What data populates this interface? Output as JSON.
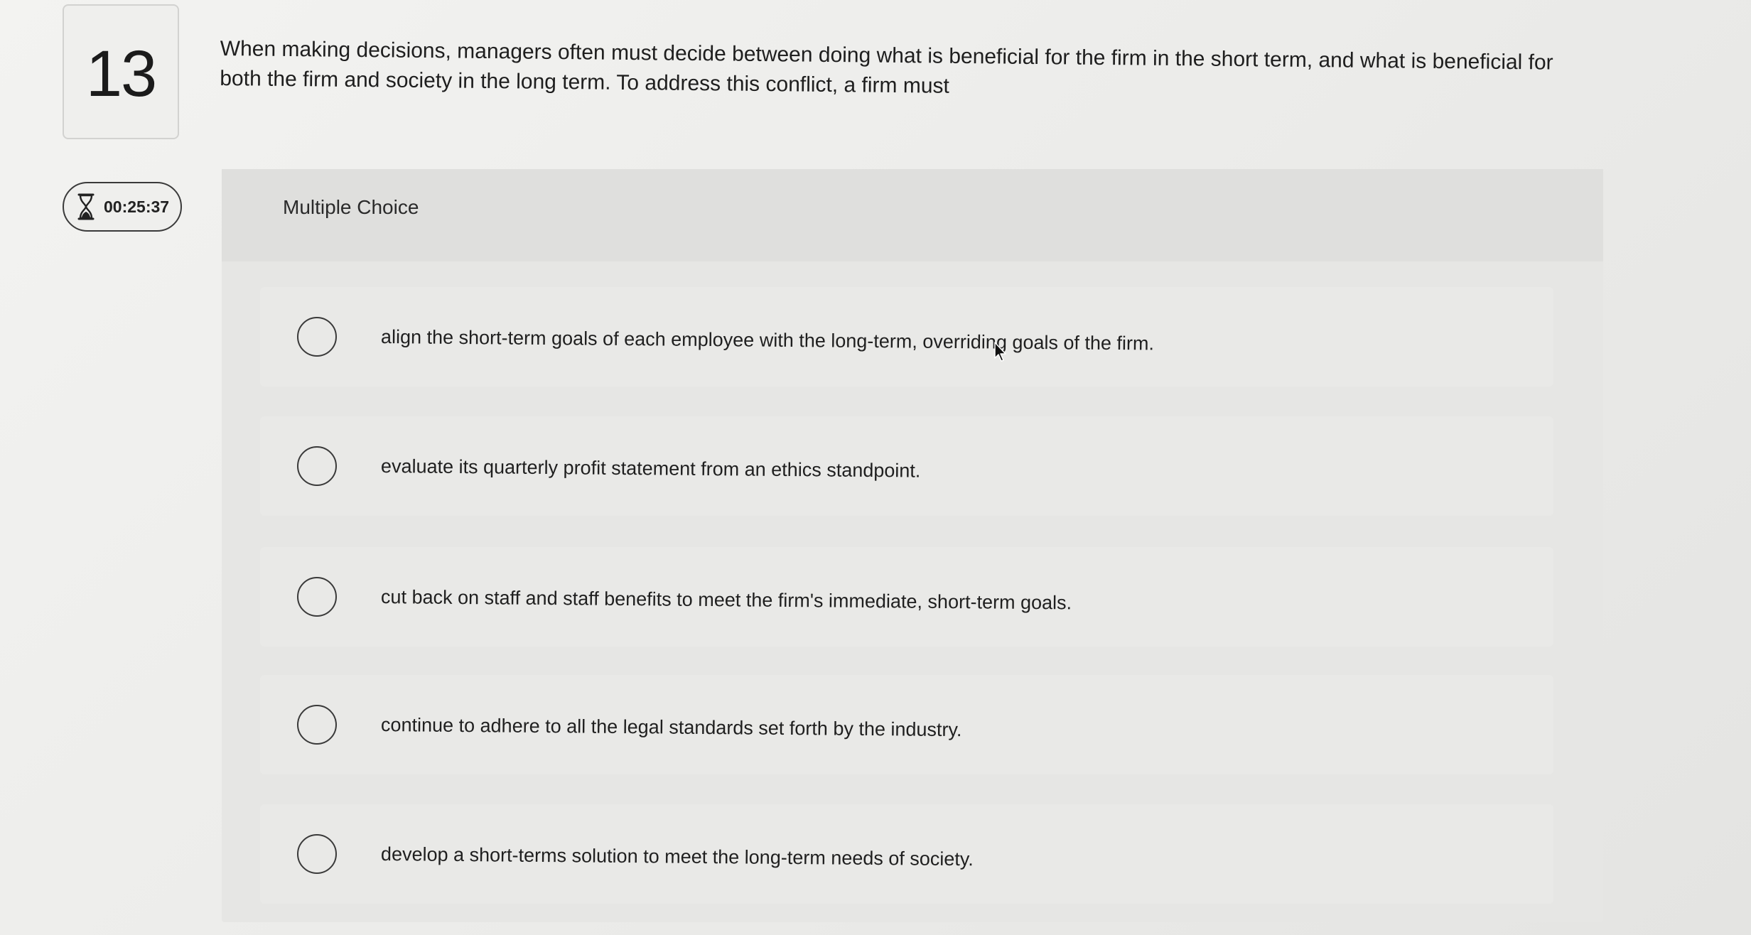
{
  "question": {
    "number": "13",
    "text": "When making decisions, managers often must decide between doing what is beneficial for the firm in the short term, and what is beneficial for both the firm and society in the long term. To address this conflict, a firm must"
  },
  "timer": {
    "icon": "hourglass-icon",
    "value": "00:25:37"
  },
  "choices": {
    "title": "Multiple Choice",
    "options": [
      {
        "label": "align the short-term goals of each employee with the long-term, overriding goals of the firm."
      },
      {
        "label": "evaluate its quarterly profit statement from an ethics standpoint."
      },
      {
        "label": "cut back on staff and staff benefits to meet the firm's immediate, short-term goals."
      },
      {
        "label": "continue to adhere to all the legal standards set forth by the industry."
      },
      {
        "label": "develop a short-terms solution to meet the long-term needs of society."
      }
    ]
  }
}
